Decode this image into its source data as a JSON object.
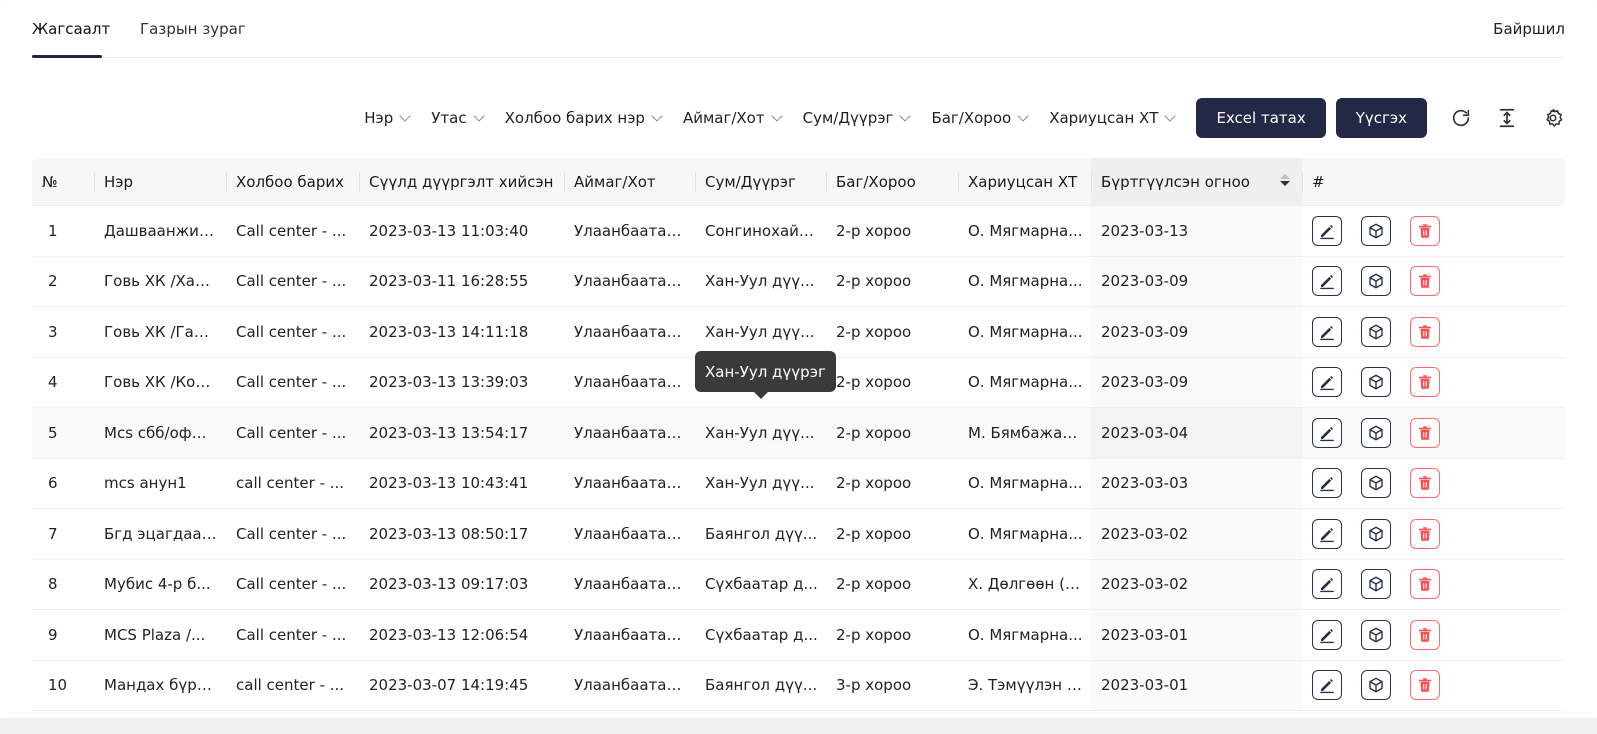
{
  "tabs": [
    {
      "label": "Жагсаалт",
      "active": true
    },
    {
      "label": "Газрын зураг",
      "active": false
    }
  ],
  "right_tab": "Байршил",
  "filters": [
    {
      "label": "Нэр"
    },
    {
      "label": "Утас"
    },
    {
      "label": "Холбоо барих нэр"
    },
    {
      "label": "Аймаг/Хот"
    },
    {
      "label": "Сум/Дүүрэг"
    },
    {
      "label": "Баг/Хороо"
    },
    {
      "label": "Хариуцсан ХТ"
    }
  ],
  "buttons": {
    "excel": "Excel татах",
    "create": "Үүсгэх"
  },
  "toolbar_icons": [
    "refresh-icon",
    "column-height-icon",
    "settings-icon"
  ],
  "columns": [
    "№",
    "Нэр",
    "Холбоо барих",
    "Сүүлд дүүргэлт хийсэн",
    "Аймаг/Хот",
    "Сум/Дүүрэг",
    "Баг/Хороо",
    "Хариуцсан ХТ",
    "Бүртгүүлсэн огноо",
    "#"
  ],
  "sorted_column": "Бүртгүүлсэн огноо",
  "rows": [
    {
      "no": "1",
      "name": "Дашваанжил...",
      "contact": "Call center - ...",
      "last_fill": "2023-03-13 11:03:40",
      "province": "Улаанбаатар ...",
      "district": "Сонгинохайр...",
      "khoroo": "2-р хороо",
      "rep": "О. Мягмарна...",
      "registered": "2023-03-13"
    },
    {
      "no": "2",
      "name": "Говь ХК /Хар...",
      "contact": "Call center - ...",
      "last_fill": "2023-03-11 16:28:55",
      "province": "Улаанбаатар ...",
      "district": "Хан-Уул дүү...",
      "khoroo": "2-р хороо",
      "rep": "О. Мягмарна...",
      "registered": "2023-03-09"
    },
    {
      "no": "3",
      "name": "Говь ХК /Гал ...",
      "contact": "Call center - ...",
      "last_fill": "2023-03-13 14:11:18",
      "province": "Улаанбаатар ...",
      "district": "Хан-Уул дүү...",
      "khoroo": "2-р хороо",
      "rep": "О. Мягмарна...",
      "registered": "2023-03-09"
    },
    {
      "no": "4",
      "name": "Говь ХК /Кор...",
      "contact": "Call center - ...",
      "last_fill": "2023-03-13 13:39:03",
      "province": "Улаанбаатар ...",
      "district": "Хан-Уул дүү...",
      "khoroo": "2-р хороо",
      "rep": "О. Мягмарна...",
      "registered": "2023-03-09"
    },
    {
      "no": "5",
      "name": "Mcs сбб/офф...",
      "contact": "Call center - ...",
      "last_fill": "2023-03-13 13:54:17",
      "province": "Улаанбаатар ...",
      "district": "Хан-Уул дүү...",
      "khoroo": "2-р хороо",
      "rep": "М. Бямбажав...",
      "registered": "2023-03-04"
    },
    {
      "no": "6",
      "name": "mcs анун1",
      "contact": "call center - ...",
      "last_fill": "2023-03-13 10:43:41",
      "province": "Улаанбаатар ...",
      "district": "Хан-Уул дүү...",
      "khoroo": "2-р хороо",
      "rep": "О. Мягмарна...",
      "registered": "2023-03-03"
    },
    {
      "no": "7",
      "name": "Бгд эцагдаа ...",
      "contact": "Call center - ...",
      "last_fill": "2023-03-13 08:50:17",
      "province": "Улаанбаатар ...",
      "district": "Баянгол дүү...",
      "khoroo": "2-р хороо",
      "rep": "О. Мягмарна...",
      "registered": "2023-03-02"
    },
    {
      "no": "8",
      "name": "Мубис 4-р б...",
      "contact": "Call center - ...",
      "last_fill": "2023-03-13 09:17:03",
      "province": "Улаанбаатар ...",
      "district": "Сүхбаатар д...",
      "khoroo": "2-р хороо",
      "rep": "Х. Дөлгөөн (S...",
      "registered": "2023-03-02"
    },
    {
      "no": "9",
      "name": "MCS Plaza /...",
      "contact": "Call center - ...",
      "last_fill": "2023-03-13 12:06:54",
      "province": "Улаанбаатар ...",
      "district": "Сүхбаатар д...",
      "khoroo": "2-р хороо",
      "rep": "О. Мягмарна...",
      "registered": "2023-03-01"
    },
    {
      "no": "10",
      "name": "Мандах бүрт...",
      "contact": "call center - ...",
      "last_fill": "2023-03-07 14:19:45",
      "province": "Улаанбаатар ...",
      "district": "Баянгол дүү...",
      "khoroo": "3-р хороо",
      "rep": "Э. Тэмүүлэн (...",
      "registered": "2023-03-01"
    }
  ],
  "row_actions": [
    "edit-icon",
    "box-icon",
    "delete-icon"
  ],
  "tooltip": "Хан-Уул дүүрэг",
  "colors": {
    "primary": "#232846",
    "danger": "#ff4d4f"
  }
}
